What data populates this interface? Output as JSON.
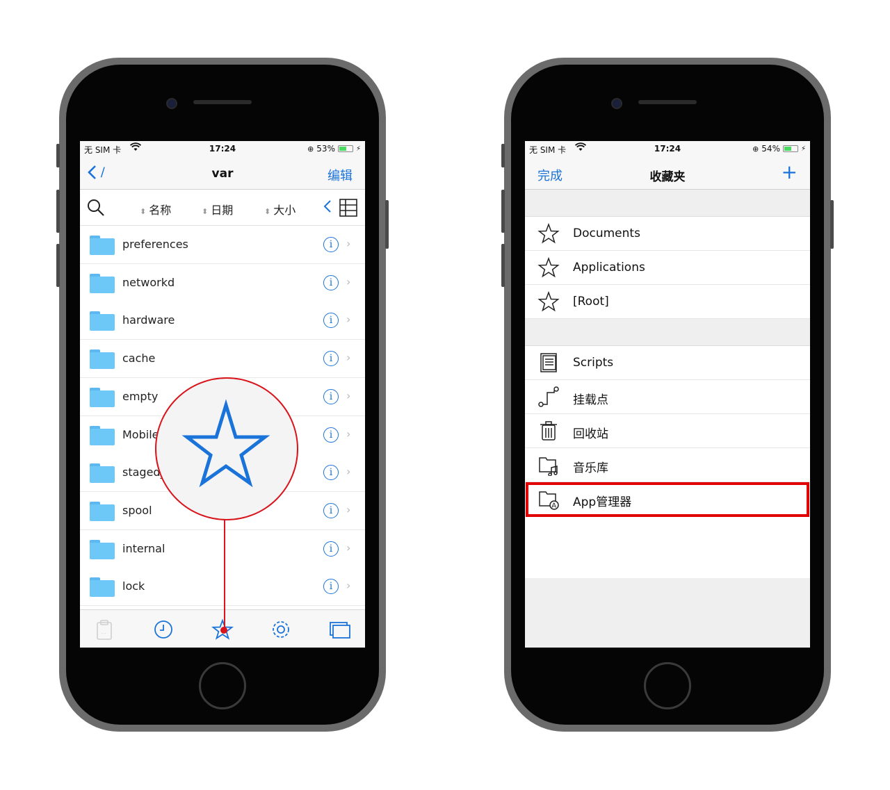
{
  "left_phone": {
    "status": {
      "carrier": "无 SIM 卡",
      "time": "17:24",
      "battery": "53%",
      "battery_level": 0.53
    },
    "nav": {
      "back_label": "/",
      "title": "var",
      "edit_label": "编辑"
    },
    "sort": {
      "name": "名称",
      "date": "日期",
      "size": "大小"
    },
    "rows": [
      {
        "name": "preferences"
      },
      {
        "name": "networkd"
      },
      {
        "name": "hardware"
      },
      {
        "name": "cache"
      },
      {
        "name": "empty"
      },
      {
        "name": "Mobile"
      },
      {
        "name": "staged_"
      },
      {
        "name": "spool"
      },
      {
        "name": "internal"
      },
      {
        "name": "lock"
      }
    ],
    "info_glyph": "i",
    "chevron_glyph": "›",
    "toolbar_icons": [
      "clipboard-icon",
      "clock-icon",
      "star-icon",
      "gear-icon",
      "windows-icon"
    ]
  },
  "right_phone": {
    "status": {
      "carrier": "无 SIM 卡",
      "time": "17:24",
      "battery": "54%",
      "battery_level": 0.54
    },
    "nav": {
      "done_label": "完成",
      "title": "收藏夹",
      "add_label": "+"
    },
    "favorites": [
      {
        "label": "Documents",
        "icon": "star-icon"
      },
      {
        "label": "Applications",
        "icon": "star-icon"
      },
      {
        "label": "[Root]",
        "icon": "star-icon"
      }
    ],
    "tools": [
      {
        "label": "Scripts",
        "icon": "scroll-icon"
      },
      {
        "label": "挂载点",
        "icon": "mount-icon"
      },
      {
        "label": "回收站",
        "icon": "trash-icon"
      },
      {
        "label": "音乐库",
        "icon": "music-folder-icon"
      },
      {
        "label": "App管理器",
        "icon": "app-folder-icon"
      }
    ]
  },
  "colors": {
    "accent": "#1a73d9",
    "highlight": "#e00000",
    "folder": "#6ec8f7"
  }
}
